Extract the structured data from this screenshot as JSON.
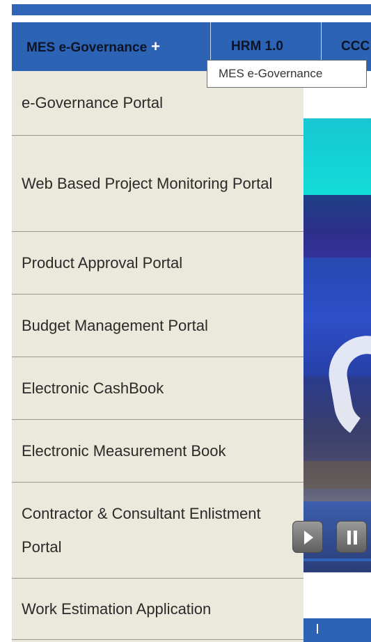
{
  "nav": {
    "items": [
      {
        "label": "MES e-Governance",
        "suffix": "+"
      },
      {
        "label": "HRM 1.0"
      },
      {
        "label": "CCC"
      }
    ]
  },
  "tooltip": {
    "text": "MES e-Governance"
  },
  "dropdown": {
    "items": [
      {
        "label": "e-Governance Portal"
      },
      {
        "label": "Web Based Project Monitoring Portal"
      },
      {
        "label": "Product Approval Portal"
      },
      {
        "label": "Budget Management Portal"
      },
      {
        "label": "Electronic CashBook"
      },
      {
        "label": "Electronic Measurement Book"
      },
      {
        "label": "Contractor & Consultant Enlistment Portal"
      },
      {
        "label": "Work Estimation Application"
      }
    ]
  },
  "slider": {
    "controls": [
      {
        "icon": "play-icon"
      },
      {
        "icon": "pause-icon"
      }
    ]
  },
  "colors": {
    "nav_blue": "#2d63b4",
    "dropdown_bg": "#ebe8dc",
    "banner_cyan": "#17c6d1"
  }
}
